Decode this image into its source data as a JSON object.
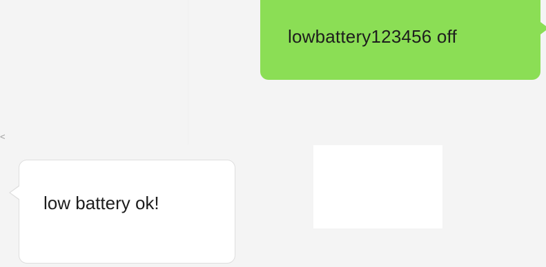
{
  "chat": {
    "messages": [
      {
        "direction": "sent",
        "text": "lowbattery123456 off"
      },
      {
        "direction": "received",
        "text": "low battery ok!"
      }
    ],
    "edge_mark": "<"
  },
  "colors": {
    "background": "#f4f4f4",
    "sent_bubble": "#8bde55",
    "received_bubble": "#ffffff",
    "text": "#1d1d1d"
  }
}
